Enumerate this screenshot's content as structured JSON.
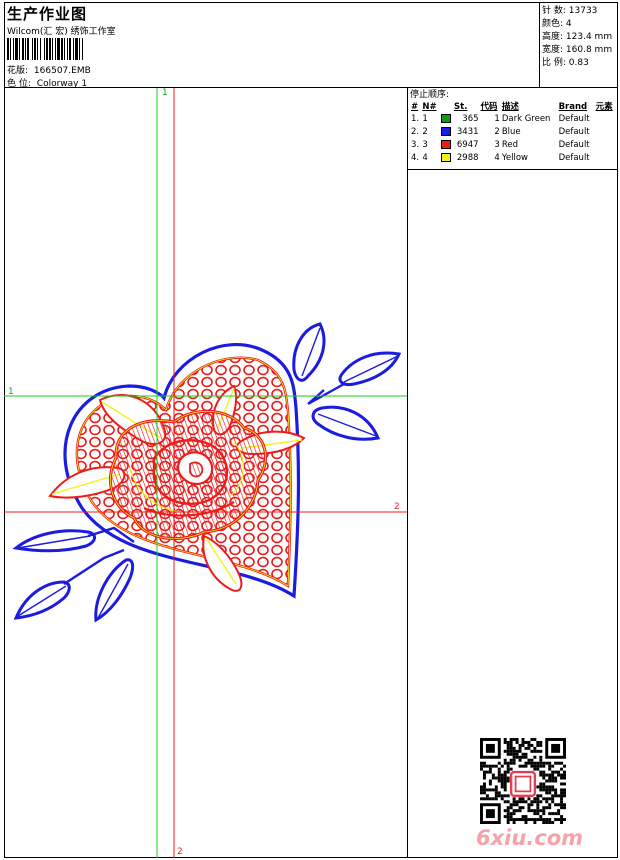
{
  "header": {
    "title": "生产作业图",
    "studio": "Wilcom(汇 宏) 绣饰工作室",
    "design_label": "花版:",
    "design_file": "166507.EMB",
    "colorway_label": "色 位:",
    "colorway": "Colorway 1"
  },
  "stats": [
    {
      "label": "针 数:",
      "value": "13733"
    },
    {
      "label": "颜色:",
      "value": "4"
    },
    {
      "label": "高度:",
      "value": "123.4 mm"
    },
    {
      "label": "宽度:",
      "value": "160.8 mm"
    },
    {
      "label": "比 例:",
      "value": "0.83"
    }
  ],
  "color_order": {
    "title": "停止顺序:",
    "columns": [
      "#",
      "N#",
      "St.",
      "代码",
      "描述",
      "Brand",
      "元素"
    ],
    "rows": [
      {
        "idx": "1.",
        "n": "1",
        "color": "#109c10",
        "stitches": "365",
        "code": "1",
        "desc": "Dark Green",
        "brand": "Default"
      },
      {
        "idx": "2.",
        "n": "2",
        "color": "#1c1ce0",
        "stitches": "3431",
        "code": "2",
        "desc": "Blue",
        "brand": "Default"
      },
      {
        "idx": "3.",
        "n": "3",
        "color": "#ec1c1c",
        "stitches": "6947",
        "code": "3",
        "desc": "Red",
        "brand": "Default"
      },
      {
        "idx": "4.",
        "n": "4",
        "color": "#f2f21a",
        "stitches": "2988",
        "code": "4",
        "desc": "Yellow",
        "brand": "Default"
      }
    ]
  },
  "axes": {
    "green_v": "1",
    "green_h": "1",
    "red_h": "2",
    "red_v": "2"
  },
  "watermark": "6xiu.com"
}
